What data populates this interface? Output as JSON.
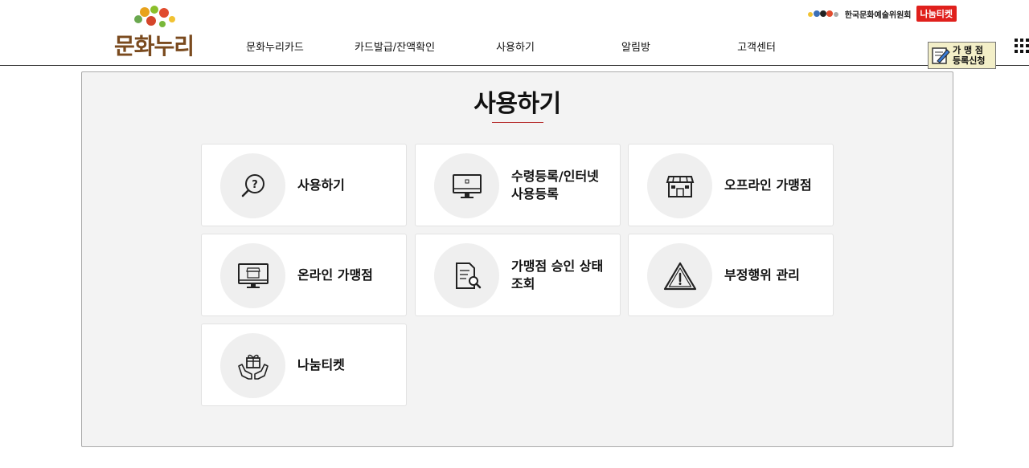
{
  "logo": {
    "text": "문화누리"
  },
  "gnb": [
    {
      "label": "문화누리카드"
    },
    {
      "label": "카드발급/잔액확인"
    },
    {
      "label": "사용하기"
    },
    {
      "label": "알림방"
    },
    {
      "label": "고객센터"
    }
  ],
  "util": {
    "org_name": "한국문화예술위원회",
    "badge": "나눔티켓"
  },
  "store_register": {
    "line1": "가 맹 점",
    "line2": "등록신청"
  },
  "panel": {
    "title": "사용하기"
  },
  "cards": [
    {
      "label": "사용하기",
      "icon": "question-magnifier-icon"
    },
    {
      "label": "수령등록/인터넷 사용등록",
      "icon": "monitor-icon"
    },
    {
      "label": "오프라인 가맹점",
      "icon": "storefront-icon"
    },
    {
      "label": "온라인 가맹점",
      "icon": "online-shop-monitor-icon"
    },
    {
      "label": "가맹점 승인 상태 조회",
      "icon": "document-search-icon"
    },
    {
      "label": "부정행위 관리",
      "icon": "warning-triangle-icon"
    },
    {
      "label": "나눔티켓",
      "icon": "gift-hands-icon"
    }
  ],
  "colors": {
    "accent": "#b22222",
    "badge": "#e0201c",
    "logo_brown": "#7a4a1e",
    "panel_bg": "#f3f3f3",
    "circle_bg": "#efefef"
  }
}
